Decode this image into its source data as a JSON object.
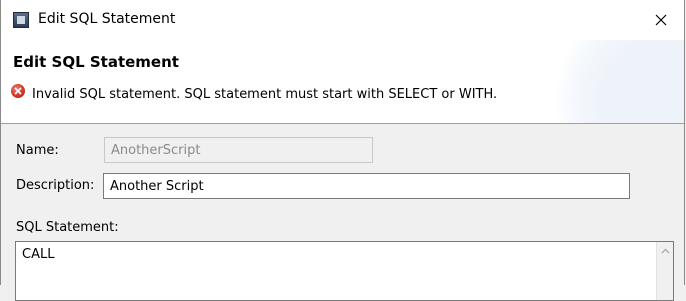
{
  "window": {
    "title": "Edit SQL Statement",
    "close_label": "×"
  },
  "banner": {
    "title": "Edit SQL Statement",
    "error_message": "Invalid SQL statement. SQL statement must start with SELECT or WITH."
  },
  "form": {
    "name_label": "Name:",
    "name_value": "AnotherScript",
    "description_label": "Description:",
    "description_value": "Another Script",
    "sql_label": "SQL Statement:",
    "sql_value": "CALL"
  },
  "icons": {
    "app": "app-window-icon",
    "close": "close-icon",
    "error": "error-icon",
    "scroll_up": "chevron-up-icon"
  },
  "colors": {
    "error": "#c42b1c",
    "disabled_text": "#8a8a8a"
  }
}
